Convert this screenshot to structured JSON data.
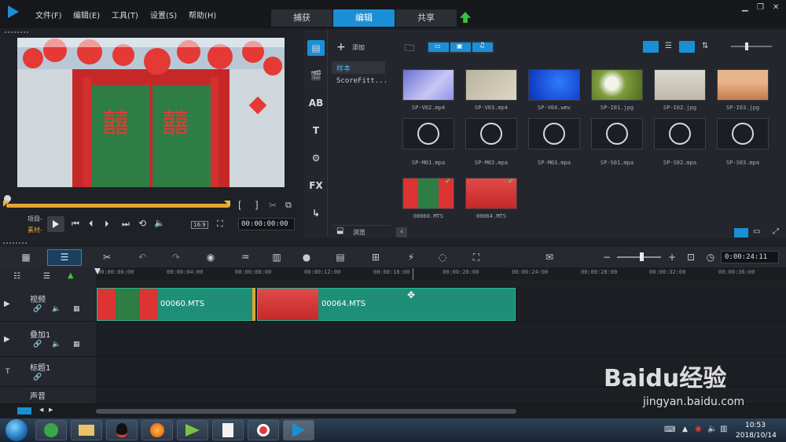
{
  "menu": {
    "items": [
      "文件(F)",
      "编辑(E)",
      "工具(T)",
      "设置(S)",
      "帮助(H)"
    ]
  },
  "tabs": {
    "capture": "捕获",
    "edit": "编辑",
    "share": "共享"
  },
  "preview": {
    "project_label": "项目-",
    "clip_label": "素材-",
    "aspect": "16:9",
    "timecode": "00:00:00:00"
  },
  "library": {
    "add_label": "添加",
    "categories": [
      "样本",
      "ScoreFitt..."
    ],
    "browse_label": "浏览",
    "items": [
      {
        "name": "SP-V02.mp4",
        "kind": "video"
      },
      {
        "name": "SP-V03.mp4",
        "kind": "video"
      },
      {
        "name": "SP-V04.wmv",
        "kind": "video"
      },
      {
        "name": "SP-I01.jpg",
        "kind": "image"
      },
      {
        "name": "SP-I02.jpg",
        "kind": "image"
      },
      {
        "name": "SP-I03.jpg",
        "kind": "image"
      },
      {
        "name": "SP-M01.mpa",
        "kind": "audio"
      },
      {
        "name": "SP-M02.mpa",
        "kind": "audio"
      },
      {
        "name": "SP-M03.mpa",
        "kind": "audio"
      },
      {
        "name": "SP-S01.mpa",
        "kind": "audio"
      },
      {
        "name": "SP-S02.mpa",
        "kind": "audio"
      },
      {
        "name": "SP-S03.mpa",
        "kind": "audio"
      },
      {
        "name": "00060.MTS",
        "kind": "clip"
      },
      {
        "name": "00064.MTS",
        "kind": "clip"
      }
    ]
  },
  "timeline": {
    "timecode": "0:00:24:11",
    "ticks": [
      "00:00:00:00",
      "00:00:04:00",
      "00:00:08:00",
      "00:00:12:00",
      "00:00:16:00",
      "00:00:20:00",
      "00:00:24:00",
      "00:00:28:00",
      "00:00:32:00",
      "00:00:36:00"
    ],
    "tracks": [
      "视频",
      "叠加1",
      "标题1",
      "声音"
    ],
    "clips": [
      "00060.MTS",
      "00064.MTS"
    ]
  },
  "taskbar": {
    "time": "10:53",
    "date": "2018/10/14"
  },
  "watermark": {
    "brand": "Baidu经验",
    "url": "jingyan.baidu.com"
  },
  "colors": {
    "accent": "#1b8fd6",
    "clip": "#1e8f76",
    "share_arrow": "#3cc23c"
  }
}
